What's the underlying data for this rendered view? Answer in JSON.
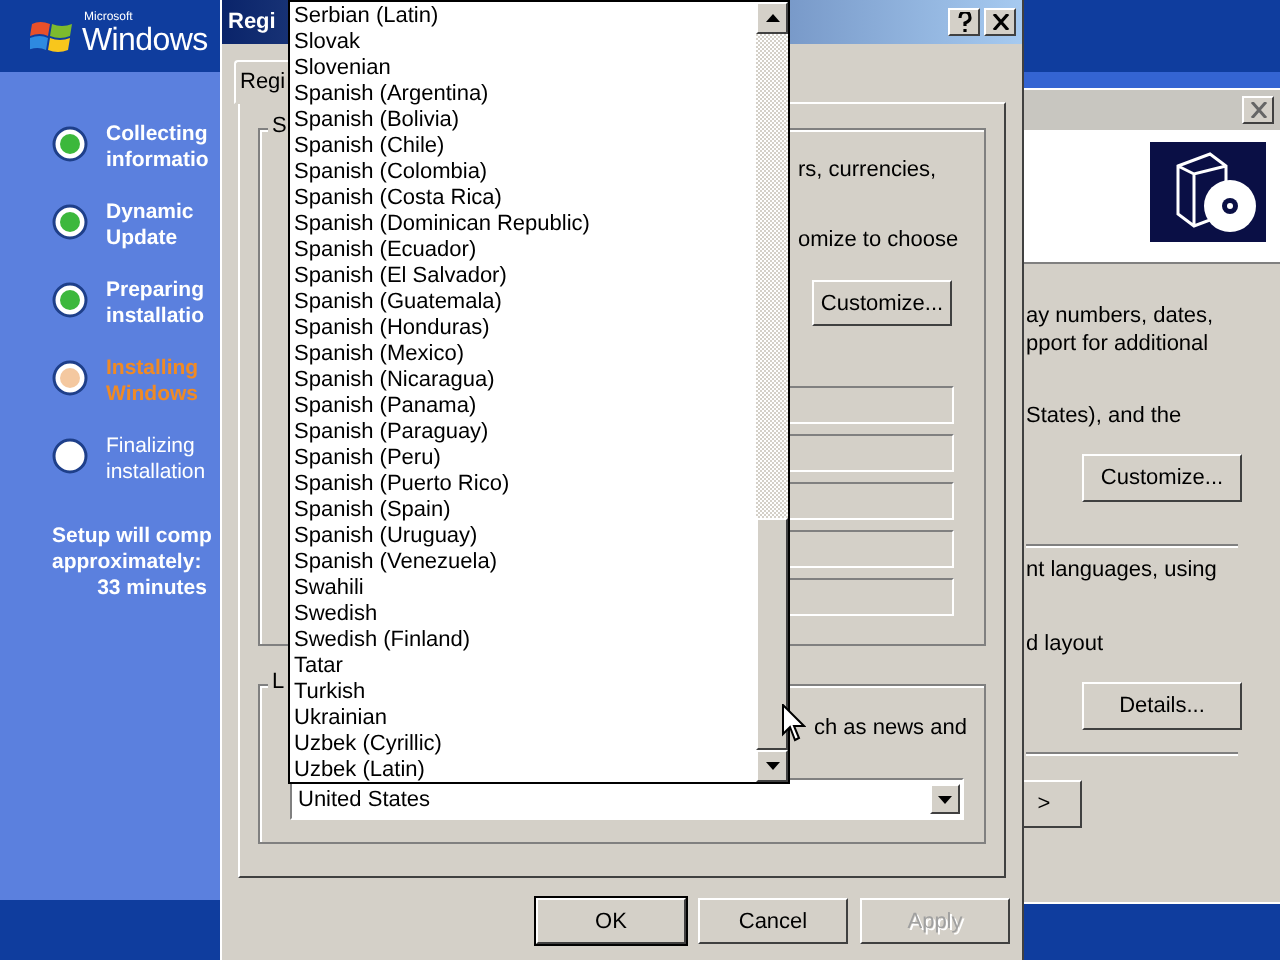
{
  "setup_sidebar": {
    "logo_small": "Microsoft",
    "logo": "Windows",
    "steps": [
      {
        "label": "Collecting informatio",
        "completed": true,
        "current": false
      },
      {
        "label": "Dynamic Update",
        "completed": true,
        "current": false
      },
      {
        "label": "Preparing installatio",
        "completed": true,
        "current": false
      },
      {
        "label": "Installing Windows",
        "completed": false,
        "current": true
      },
      {
        "label": "Finalizing installation",
        "completed": false,
        "current": false
      }
    ],
    "estimate": [
      "Setup will comp",
      "approximately:",
      "33 minutes"
    ]
  },
  "back_window": {
    "texts": [
      "ay numbers, dates,",
      "pport for additional",
      "States), and the"
    ],
    "customize_button": "Customize...",
    "texts_2": [
      "nt languages, using",
      "d layout"
    ],
    "details_button": "Details...",
    "next_button": ">"
  },
  "dialog": {
    "title": "Regi",
    "tabs": [
      {
        "label": "Regi",
        "selected": true
      }
    ],
    "group_1_label": "S",
    "group_1_texts": [
      "rs, currencies,",
      "omize to choose"
    ],
    "customize_button": "Customize...",
    "group_2_label": "L",
    "group_2_text": "ch as news and",
    "location_value": "United States",
    "buttons": [
      {
        "label": "OK",
        "disabled": false
      },
      {
        "label": "Cancel",
        "disabled": false
      },
      {
        "label": "Apply",
        "disabled": true
      }
    ]
  },
  "dropdown_list": {
    "items": [
      "Serbian (Latin)",
      "Slovak",
      "Slovenian",
      "Spanish (Argentina)",
      "Spanish (Bolivia)",
      "Spanish (Chile)",
      "Spanish (Colombia)",
      "Spanish (Costa Rica)",
      "Spanish (Dominican Republic)",
      "Spanish (Ecuador)",
      "Spanish (El Salvador)",
      "Spanish (Guatemala)",
      "Spanish (Honduras)",
      "Spanish (Mexico)",
      "Spanish (Nicaragua)",
      "Spanish (Panama)",
      "Spanish (Paraguay)",
      "Spanish (Peru)",
      "Spanish (Puerto Rico)",
      "Spanish (Spain)",
      "Spanish (Uruguay)",
      "Spanish (Venezuela)",
      "Swahili",
      "Swedish",
      "Swedish (Finland)",
      "Tatar",
      "Turkish",
      "Ukrainian",
      "Uzbek (Cyrillic)",
      "Uzbek (Latin)"
    ]
  }
}
